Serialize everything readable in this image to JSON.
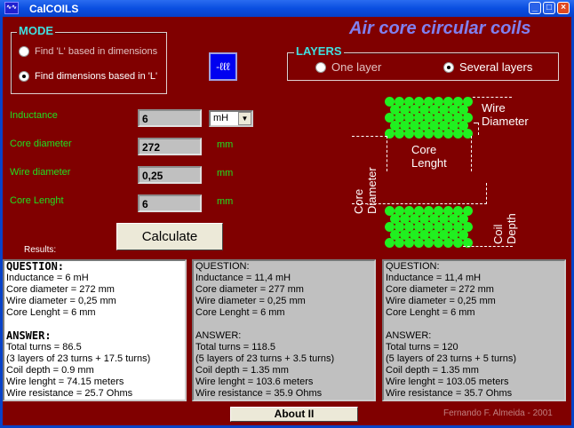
{
  "window": {
    "title": "CalCOILS",
    "app_icon": "coil-app-icon",
    "buttons": [
      "minimize",
      "maximize",
      "close"
    ]
  },
  "heading": "Air core circular coils",
  "mode": {
    "legend": "MODE",
    "options": [
      {
        "label": "Find 'L' based in dimensions",
        "selected": false
      },
      {
        "label": "Find dimensions based in 'L'",
        "selected": true
      }
    ]
  },
  "layers": {
    "legend": "LAYERS",
    "options": [
      {
        "label": "One layer",
        "selected": false
      },
      {
        "label": "Several layers",
        "selected": true
      }
    ]
  },
  "inputs": {
    "inductance": {
      "label": "Inductance",
      "value": "6",
      "unit": "mH"
    },
    "core_diameter": {
      "label": "Core diameter",
      "value": "272",
      "unit": "mm"
    },
    "wire_diameter": {
      "label": "Wire diameter",
      "value": "0,25",
      "unit": "mm"
    },
    "core_length": {
      "label": "Core Lenght",
      "value": "6",
      "unit": "mm"
    }
  },
  "calculate_label": "Calculate",
  "results_label": "Results:",
  "diagram": {
    "wire_diameter": [
      "Wire",
      "Diameter"
    ],
    "core_length": [
      "Core",
      "Lenght"
    ],
    "core_diameter": [
      "Core",
      "Diameter"
    ],
    "coil_depth": [
      "Coil",
      "Depth"
    ]
  },
  "results": [
    {
      "question": "QUESTION:",
      "q": [
        "Inductance = 6 mH",
        "Core diameter = 272 mm",
        "Wire diameter = 0,25 mm",
        "Core Lenght = 6 mm"
      ],
      "answer": "ANSWER:",
      "a": [
        "Total turns = 86.5",
        "(3 layers of 23 turns + 17.5 turns)",
        "Coil depth = 0.9 mm",
        "Wire lenght = 74.15 meters",
        "Wire resistance = 25.7 Ohms"
      ]
    },
    {
      "question": "QUESTION:",
      "q": [
        "Inductance = 11,4 mH",
        "Core diameter = 277 mm",
        "Wire diameter = 0,25 mm",
        "Core Lenght = 6 mm"
      ],
      "answer": "ANSWER:",
      "a": [
        "Total turns = 118.5",
        "(5 layers of 23 turns + 3.5 turns)",
        "Coil depth = 1.35 mm",
        "Wire lenght = 103.6 meters",
        "Wire resistance = 35.9 Ohms"
      ]
    },
    {
      "question": "QUESTION:",
      "q": [
        "Inductance = 11,4 mH",
        "Core diameter = 272 mm",
        "Wire diameter = 0,25 mm",
        "Core Lenght = 6 mm"
      ],
      "answer": "ANSWER:",
      "a": [
        "Total turns = 120",
        "(5 layers of 23 turns + 5 turns)",
        "Coil depth = 1.35 mm",
        "Wire lenght = 103.05 meters",
        "Wire resistance = 35.7 Ohms"
      ]
    }
  ],
  "about_label": "About II",
  "credit": "Fernando F. Almeida - 2001"
}
